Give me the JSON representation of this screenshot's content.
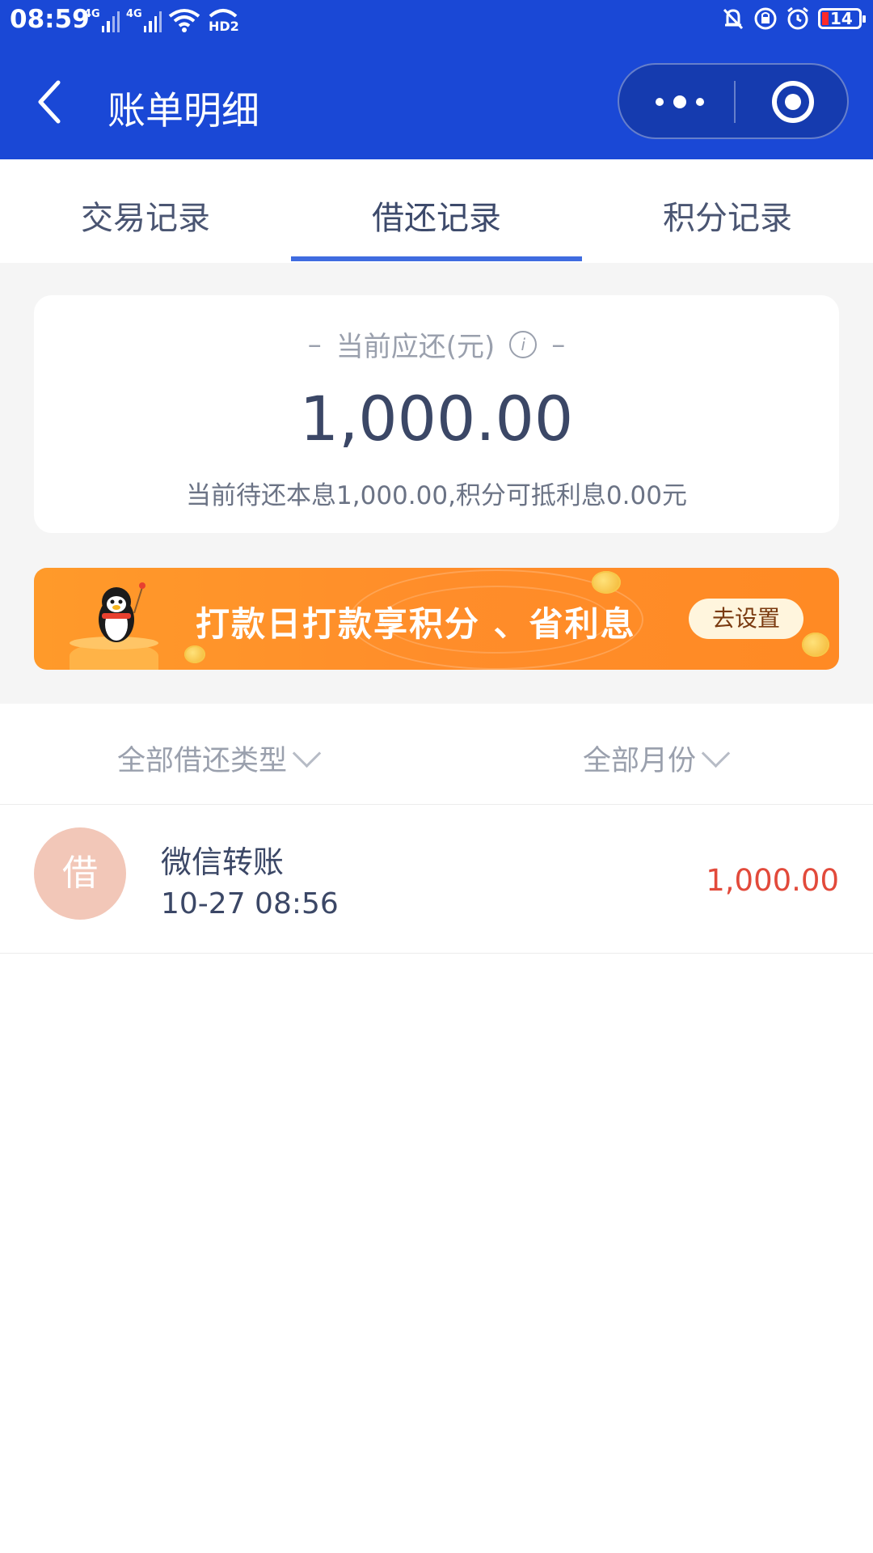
{
  "status_bar": {
    "time": "08:59",
    "network_1": "4G",
    "network_2": "4G",
    "hd": "HD2",
    "battery": "14"
  },
  "navbar": {
    "title": "账单明细"
  },
  "tabs": [
    {
      "label": "交易记录",
      "active": false
    },
    {
      "label": "借还记录",
      "active": true
    },
    {
      "label": "积分记录",
      "active": false
    }
  ],
  "summary": {
    "label": "当前应还(元)",
    "dash": "–",
    "info_icon": "i",
    "amount": "1,000.00",
    "detail": "当前待还本息1,000.00,积分可抵利息0.00元"
  },
  "banner": {
    "text": "打款日打款享积分 、省利息",
    "button": "去设置"
  },
  "filters": {
    "type": "全部借还类型",
    "month": "全部月份"
  },
  "records": [
    {
      "avatar": "借",
      "title": "微信转账",
      "time": "10-27 08:56",
      "amount": "1,000.00"
    }
  ],
  "colors": {
    "header_bg": "#1a48d6",
    "tab_indicator": "#3f6ce0",
    "amount_red": "#e24a3b",
    "banner_orange": "#ff8d2a",
    "avatar_bg": "#f2c7b8"
  }
}
